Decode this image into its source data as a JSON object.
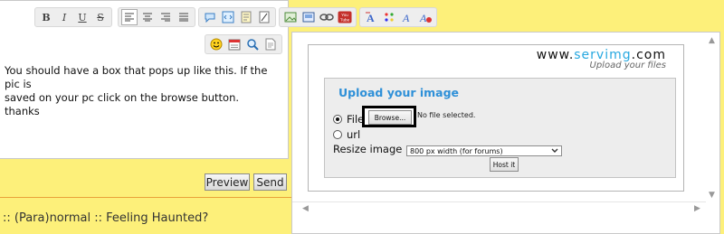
{
  "editor": {
    "toolbar1": [
      {
        "group": "format",
        "buttons": [
          {
            "name": "bold-icon",
            "glyph": "B"
          },
          {
            "name": "italic-icon",
            "glyph": "I"
          },
          {
            "name": "underline-icon",
            "glyph": "U"
          },
          {
            "name": "strikethrough-icon",
            "glyph": "S"
          }
        ]
      },
      {
        "group": "align",
        "buttons": [
          {
            "name": "align-left-icon"
          },
          {
            "name": "align-center-icon"
          },
          {
            "name": "align-right-icon"
          },
          {
            "name": "align-justify-icon"
          }
        ]
      },
      {
        "group": "insert",
        "buttons": [
          {
            "name": "quote-icon"
          },
          {
            "name": "code-icon"
          },
          {
            "name": "spoiler-icon"
          },
          {
            "name": "edit-icon"
          }
        ]
      },
      {
        "group": "media",
        "buttons": [
          {
            "name": "image-icon"
          },
          {
            "name": "host-image-icon"
          },
          {
            "name": "link-icon"
          },
          {
            "name": "youtube-icon",
            "glyph": "You Tube"
          }
        ]
      },
      {
        "group": "font",
        "buttons": [
          {
            "name": "font-size-icon"
          },
          {
            "name": "font-color-icon"
          },
          {
            "name": "font-face-icon"
          },
          {
            "name": "clear-format-icon"
          }
        ]
      }
    ],
    "toolbar2": [
      {
        "name": "smiley-icon"
      },
      {
        "name": "calendar-icon"
      },
      {
        "name": "search-icon"
      },
      {
        "name": "document-icon"
      }
    ],
    "message_lines": [
      "You should have a box that pops up like this. If the pic is",
      "saved on your pc click on the browse button.",
      "thanks"
    ],
    "preview_label": "Preview",
    "send_label": "Send"
  },
  "forum_title": ":: (Para)normal :: Feeling Haunted?",
  "popup": {
    "logo_main_dark": "www.",
    "logo_main_blue": "servimg",
    "logo_main_tail": ".com",
    "logo_tagline": "Upload your files",
    "upload_title": "Upload your image",
    "file_label": "File",
    "url_label": "url",
    "browse_label": "Browse...",
    "no_file_text": "No file selected.",
    "resize_label": "Resize image",
    "resize_value": "800 px width (for forums)",
    "host_button": "Host it",
    "selected_source": "file"
  },
  "colors": {
    "page_background": "#fdf07a",
    "accent_blue": "#2e90d8",
    "rule": "#e9a23a"
  }
}
